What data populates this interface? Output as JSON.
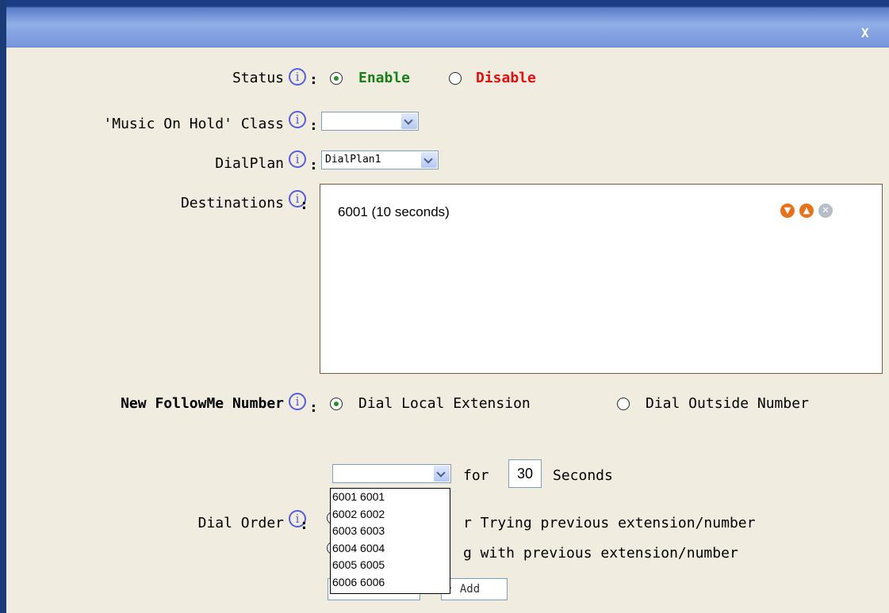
{
  "dialog": {
    "close_label": "X"
  },
  "status": {
    "label": "Status",
    "enable": "Enable",
    "disable": "Disable",
    "selected": "Enable"
  },
  "moh": {
    "label": "'Music On Hold' Class",
    "value": ""
  },
  "dialplan": {
    "label": "DialPlan",
    "value": "DialPlan1"
  },
  "destinations": {
    "label": "Destinations",
    "items": [
      "6001 (10 seconds)"
    ]
  },
  "new_followme": {
    "label": "New FollowMe Number",
    "option_local": "Dial Local Extension",
    "option_outside": "Dial Outside Number",
    "selected": "Dial Local Extension"
  },
  "ring": {
    "extension_value": "",
    "for_label": "for",
    "seconds_value": "30",
    "seconds_label": "Seconds"
  },
  "dial_order": {
    "label": "Dial Order",
    "option_after": "r Trying previous extension/number",
    "option_along": "g with previous extension/number"
  },
  "extension_options": [
    "6001 6001",
    "6002 6002",
    "6003 6003",
    "6004 6004",
    "6005 6005",
    "6006 6006"
  ],
  "add_button": {
    "label": "Add",
    "icon": "up-arrow-icon"
  },
  "colors": {
    "enable": "#1a7f1a",
    "disable": "#e01010",
    "info_icon": "#5560d8",
    "titlebar": "#7896dc"
  }
}
